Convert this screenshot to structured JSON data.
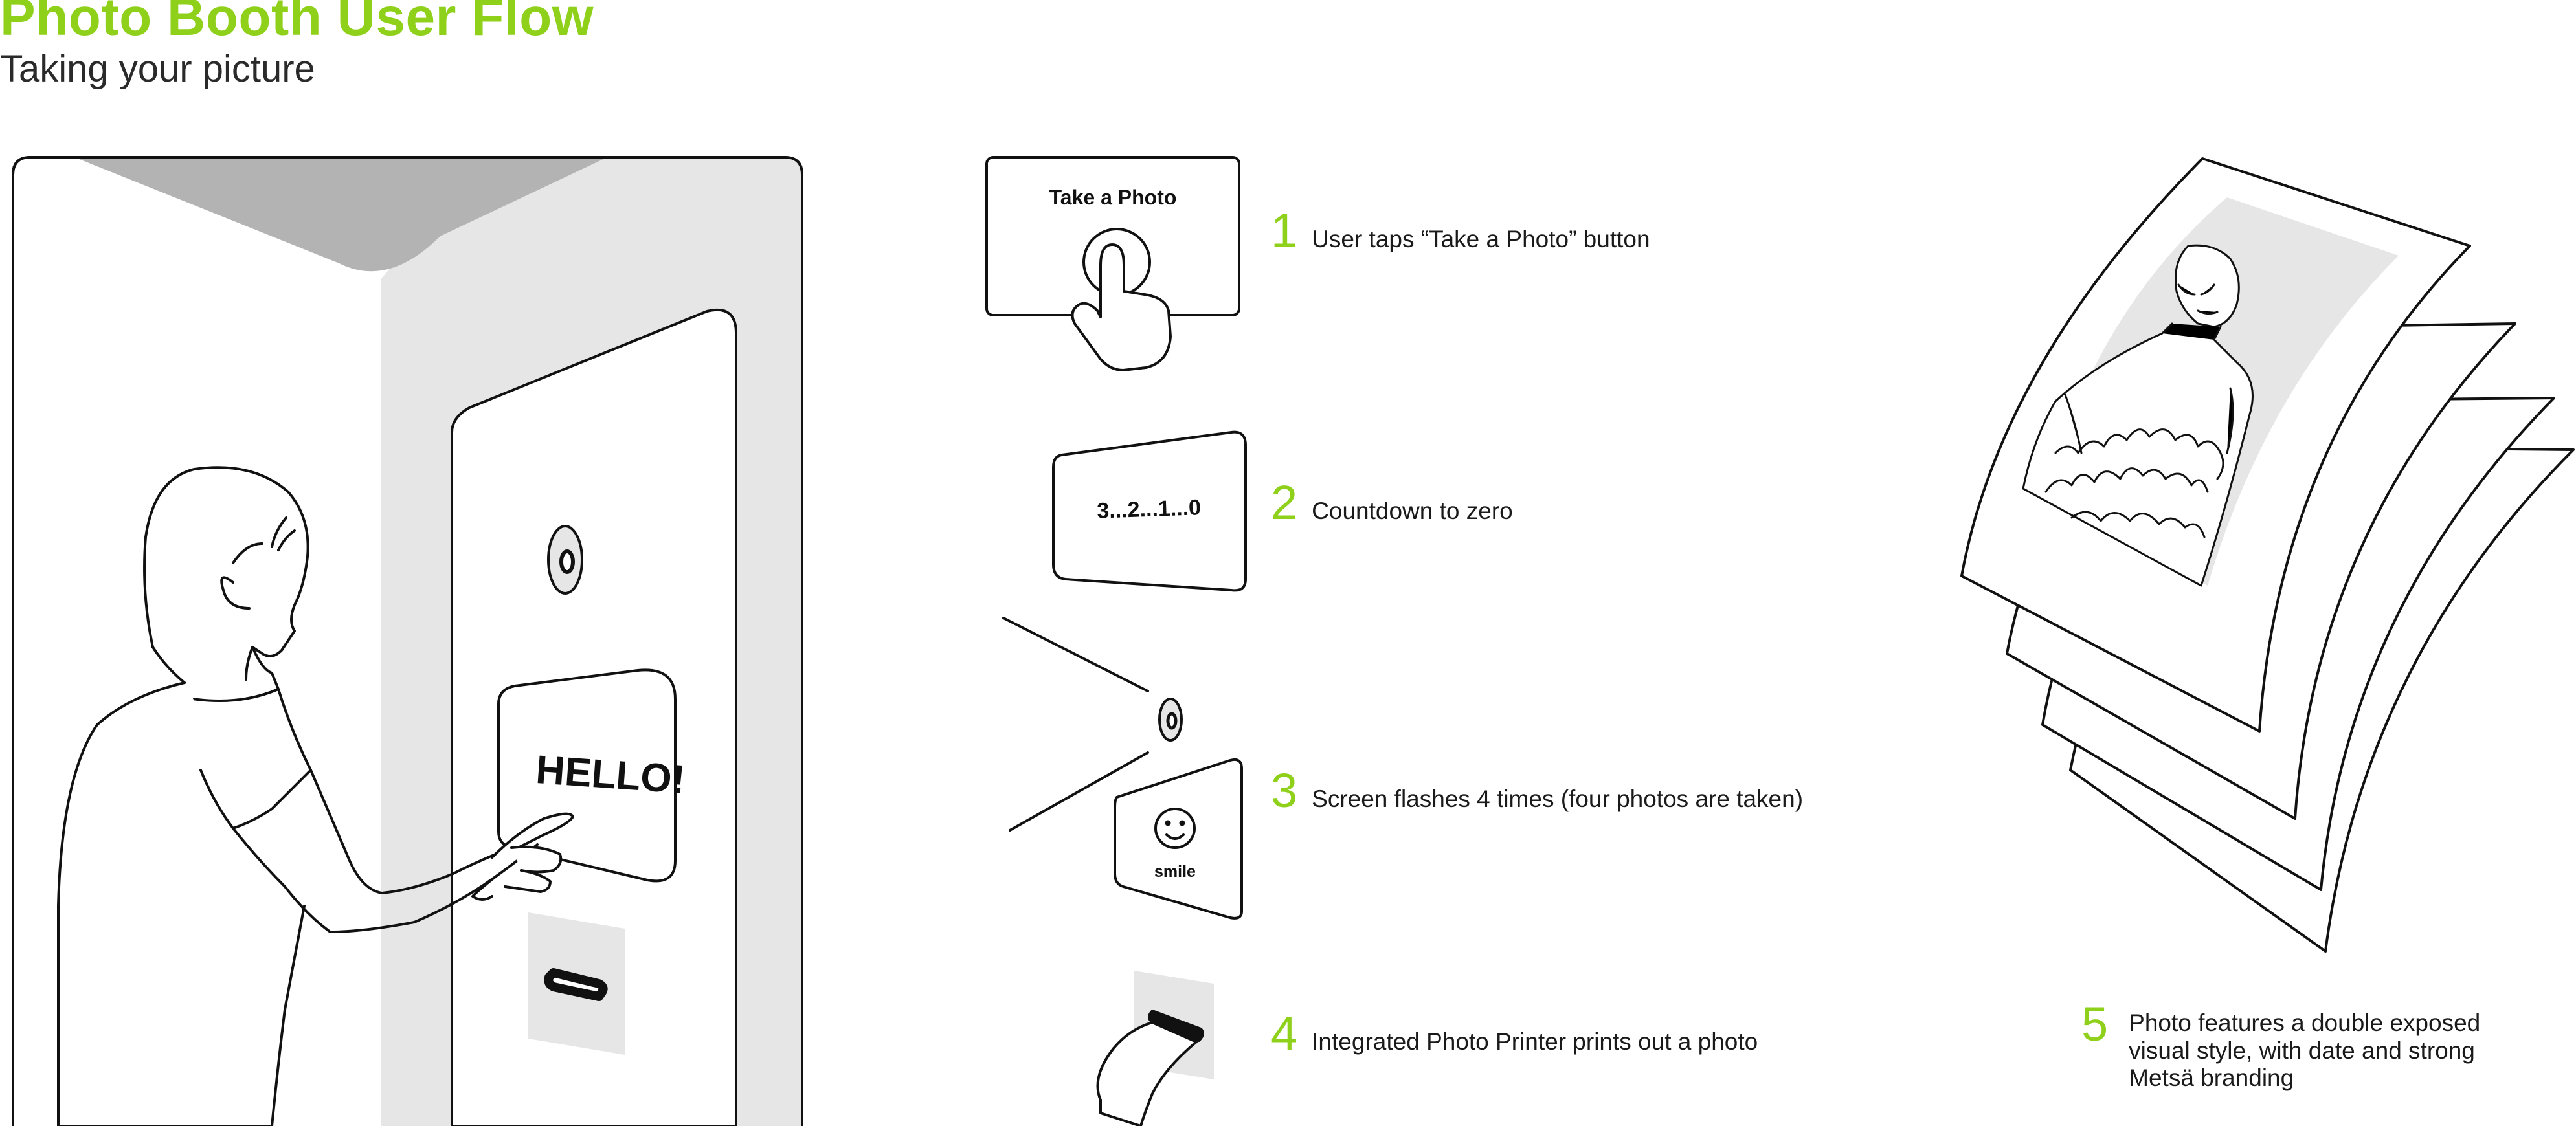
{
  "header": {
    "title": "Photo Booth User Flow",
    "subtitle": "Taking your picture"
  },
  "booth": {
    "screen_text": "HELLO!"
  },
  "screens": {
    "take_photo_label": "Take a Photo",
    "countdown_label": "3...2...1...0",
    "smile_label": "smile"
  },
  "steps": [
    {
      "number": "1",
      "text": "User taps “Take a Photo” button"
    },
    {
      "number": "2",
      "text": "Countdown to zero"
    },
    {
      "number": "3",
      "text": "Screen flashes 4 times (four photos are taken)"
    },
    {
      "number": "4",
      "text": "Integrated Photo Printer prints out a photo"
    },
    {
      "number": "5",
      "text": "Photo features a double exposed visual style, with date and strong Metsä branding"
    }
  ],
  "colors": {
    "accent": "#8fd01b",
    "line": "#111111",
    "booth_gray": "#e6e6e6",
    "top_gray": "#b3b3b3"
  },
  "icons": [
    "hand-pointer-icon",
    "camera-lens-icon",
    "smiley-face-icon",
    "printer-slot-icon"
  ]
}
